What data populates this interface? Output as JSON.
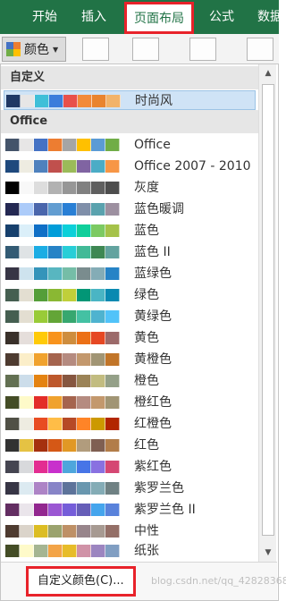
{
  "ribbon": {
    "tabs": [
      {
        "label": "开始"
      },
      {
        "label": "插入"
      },
      {
        "label": "页面布局"
      },
      {
        "label": "公式"
      },
      {
        "label": "数据"
      }
    ],
    "colors_button": {
      "label": "颜色",
      "caret": "▼"
    }
  },
  "dropdown": {
    "sections": [
      {
        "title": "自定义",
        "themes": [
          {
            "name": "时尚风",
            "colors": [
              "#1f3864",
              "#e7e6e6",
              "#3fbfd8",
              "#3c7ddb",
              "#e8504b",
              "#f28a3a",
              "#e9842f",
              "#f2b36a"
            ]
          }
        ]
      },
      {
        "title": "Office",
        "themes": [
          {
            "name": "Office",
            "colors": [
              "#44546a",
              "#e7e6e6",
              "#4472c4",
              "#ed7d31",
              "#a5a5a5",
              "#ffc000",
              "#5b9bd5",
              "#70ad47"
            ]
          },
          {
            "name": "Office 2007 - 2010",
            "colors": [
              "#1f497d",
              "#eeece1",
              "#4f81bd",
              "#c0504d",
              "#9bbb59",
              "#8064a2",
              "#4bacc6",
              "#f79646"
            ]
          },
          {
            "name": "灰度",
            "colors": [
              "#000000",
              "#f8f8f8",
              "#dddddd",
              "#b2b2b2",
              "#969696",
              "#808080",
              "#5f5f5f",
              "#4d4d4d"
            ]
          },
          {
            "name": "蓝色暖调",
            "colors": [
              "#242852",
              "#accbf9",
              "#4a66ac",
              "#629dd1",
              "#297fd5",
              "#7f8fa9",
              "#5aa2ae",
              "#9d90a0"
            ]
          },
          {
            "name": "蓝色",
            "colors": [
              "#17406d",
              "#dbeff9",
              "#0f6fc6",
              "#009dd9",
              "#0bd0d9",
              "#10cf9b",
              "#7cca62",
              "#a5c249"
            ]
          },
          {
            "name": "蓝色 II",
            "colors": [
              "#335b74",
              "#dfe3e5",
              "#1cade4",
              "#2683c6",
              "#27ced7",
              "#42ba97",
              "#3e8853",
              "#62a39f"
            ]
          },
          {
            "name": "蓝绿色",
            "colors": [
              "#373545",
              "#cee3ee",
              "#3494ba",
              "#58b6c0",
              "#75bda7",
              "#7a8c8e",
              "#84acb6",
              "#2683c6"
            ]
          },
          {
            "name": "绿色",
            "colors": [
              "#455f51",
              "#e3ded1",
              "#549e39",
              "#8ab833",
              "#c0cf3a",
              "#029676",
              "#4ab5c4",
              "#0989b1"
            ]
          },
          {
            "name": "黄绿色",
            "colors": [
              "#455f51",
              "#e3ded1",
              "#99cb38",
              "#63a537",
              "#37a76f",
              "#44c1a3",
              "#4eb3cf",
              "#51c3f9"
            ]
          },
          {
            "name": "黄色",
            "colors": [
              "#39302a",
              "#e5dedb",
              "#ffca08",
              "#f8931d",
              "#ce8d3e",
              "#ec7016",
              "#e64823",
              "#9c6a6a"
            ]
          },
          {
            "name": "黄橙色",
            "colors": [
              "#4e3b30",
              "#fbeec9",
              "#f0a22e",
              "#a5644e",
              "#b58b80",
              "#c3986d",
              "#a19574",
              "#c17529"
            ]
          },
          {
            "name": "橙色",
            "colors": [
              "#637052",
              "#ccddea",
              "#e48312",
              "#bd582c",
              "#865640",
              "#9b8357",
              "#c2bc80",
              "#94a088"
            ]
          },
          {
            "name": "橙红色",
            "colors": [
              "#444d26",
              "#fefac9",
              "#e32d28",
              "#f0a22e",
              "#a5644e",
              "#b58b80",
              "#c3986d",
              "#a19574"
            ]
          },
          {
            "name": "红橙色",
            "colors": [
              "#505046",
              "#eeece1",
              "#e84c22",
              "#ffbd47",
              "#b64926",
              "#ff8427",
              "#cc9900",
              "#b22600"
            ]
          },
          {
            "name": "红色",
            "colors": [
              "#323232",
              "#e5c243",
              "#a5300f",
              "#d55816",
              "#e19825",
              "#b19c7d",
              "#7f5f52",
              "#b27d49"
            ]
          },
          {
            "name": "紫红色",
            "colors": [
              "#454551",
              "#d8d9dc",
              "#e32d91",
              "#c830cc",
              "#4ea6dc",
              "#4775e7",
              "#8971e1",
              "#d54773"
            ]
          },
          {
            "name": "紫罗兰色",
            "colors": [
              "#373545",
              "#dceaf1",
              "#ad84c6",
              "#8784c7",
              "#5d739a",
              "#6997af",
              "#84acb6",
              "#6f8183"
            ]
          },
          {
            "name": "紫罗兰色 II",
            "colors": [
              "#632e62",
              "#eae5eb",
              "#92278f",
              "#9b57d3",
              "#755dd9",
              "#665eb8",
              "#45a5ed",
              "#5982db"
            ]
          },
          {
            "name": "中性",
            "colors": [
              "#4e3b30",
              "#dbd4ca",
              "#dcbd23",
              "#9ba36e",
              "#be9066",
              "#98858b",
              "#a79a92",
              "#946f67"
            ]
          },
          {
            "name": "纸张",
            "colors": [
              "#444d26",
              "#fefac9",
              "#a5b592",
              "#f3a447",
              "#e7bc29",
              "#d092a7",
              "#9c85c0",
              "#809ec2"
            ]
          }
        ]
      }
    ],
    "footer": {
      "custom_colors_label": "自定义颜色(C)...",
      "watermark": "blog.csdn.net/qq_42828368"
    }
  }
}
